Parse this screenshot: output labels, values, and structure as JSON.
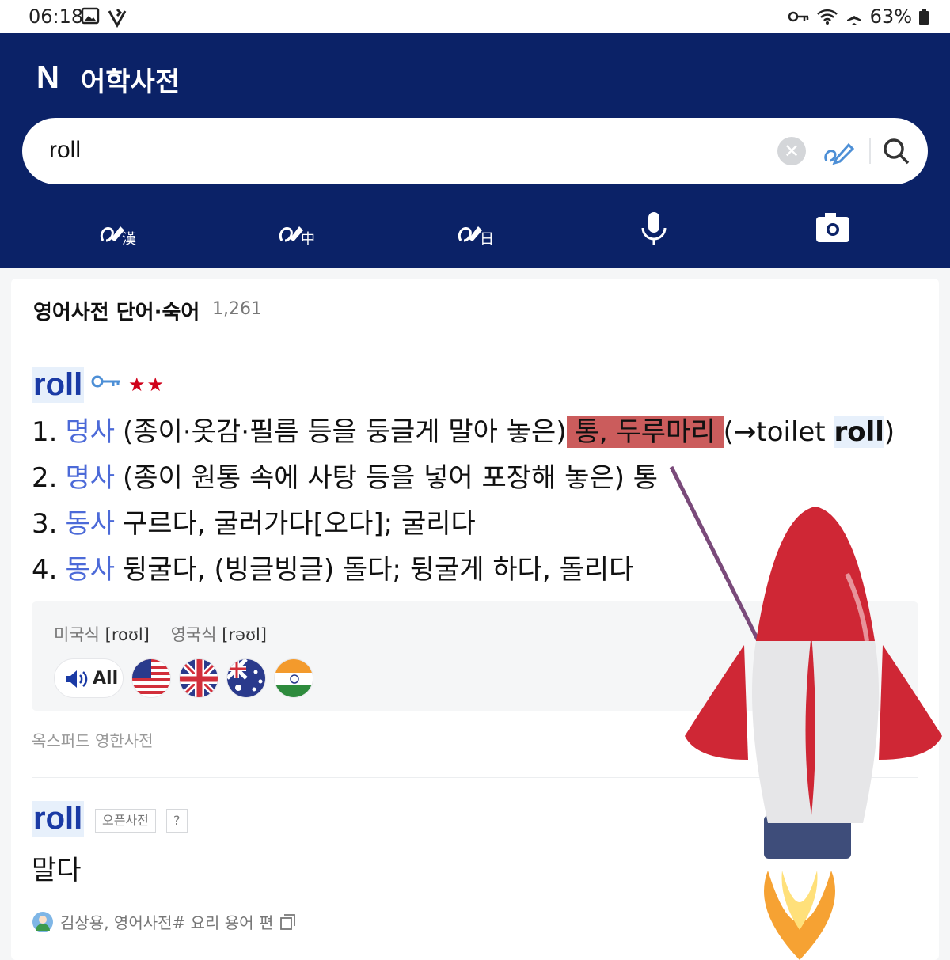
{
  "statusbar": {
    "time": "06:18",
    "battery": "63%"
  },
  "header": {
    "logo": "N",
    "title": "어학사전"
  },
  "search": {
    "query": "roll"
  },
  "tools": [
    {
      "name": "hanja-handwriting-icon",
      "glyph": "漢"
    },
    {
      "name": "chinese-handwriting-icon",
      "glyph": "中"
    },
    {
      "name": "japanese-handwriting-icon",
      "glyph": "日"
    },
    {
      "name": "microphone-icon",
      "glyph": ""
    },
    {
      "name": "camera-icon",
      "glyph": ""
    }
  ],
  "section": {
    "title": "영어사전 단어·숙어",
    "count": "1,261"
  },
  "entry": {
    "word": "roll",
    "stars": "★★",
    "meanings": [
      {
        "num": "1.",
        "pos": "명사",
        "pre": "(종이·옷감·필름 등을 둥글게 말아 놓은)",
        "hl": "통, 두루마리",
        "post_a": "(→toilet ",
        "post_b": "roll",
        "post_c": ")"
      },
      {
        "num": "2.",
        "pos": "명사",
        "text": "(종이 원통 속에 사탕 등을 넣어 포장해 놓은) 통"
      },
      {
        "num": "3.",
        "pos": "동사",
        "text": "구르다, 굴러가다[오다]; 굴리다"
      },
      {
        "num": "4.",
        "pos": "동사",
        "text": "뒹굴다, (빙글빙글) 돌다; 뒹굴게 하다, 돌리다"
      }
    ],
    "pron": {
      "us_label": "미국식",
      "us_ipa": "[roʊl]",
      "uk_label": "영국식",
      "uk_ipa": "[rəʊl]",
      "all_label": "All"
    },
    "source": "옥스퍼드 영한사전"
  },
  "entry2": {
    "word": "roll",
    "badge": "오픈사전",
    "help": "?",
    "meaning": "말다",
    "author": "김상용, 영어사전# 요리 용어 편"
  },
  "colors": {
    "header": "#0b2267",
    "accent": "#1a3aa5",
    "pos": "#4c6ad8",
    "highlight": "#cb5c5c",
    "stars": "#d0021b"
  }
}
